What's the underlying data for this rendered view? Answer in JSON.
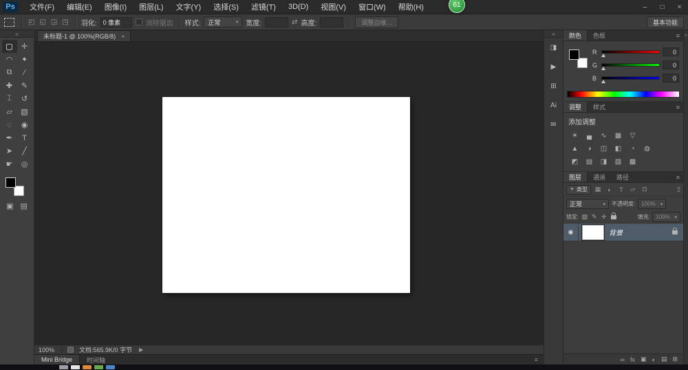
{
  "window": {
    "badge": "61",
    "minimize": "–",
    "maximize": "□",
    "close": "×"
  },
  "menubar": {
    "logo": "Ps",
    "items": [
      "文件(F)",
      "编辑(E)",
      "图像(I)",
      "图层(L)",
      "文字(Y)",
      "选择(S)",
      "滤镜(T)",
      "3D(D)",
      "视图(V)",
      "窗口(W)",
      "帮助(H)"
    ]
  },
  "options_bar": {
    "feather_label": "羽化:",
    "feather_value": "0 像素",
    "anti_alias_label": "消除锯齿",
    "style_label": "样式:",
    "style_value": "正常",
    "width_label": "宽度:",
    "width_value": "",
    "height_label": "高度:",
    "height_value": "",
    "refine_edge_label": "调整边缘…",
    "workspace_label": "基本功能"
  },
  "icons": {
    "caret": "▾",
    "swap": "⇄",
    "menu": "≡",
    "collapse_left": "«",
    "collapse_up": "«",
    "modes": [
      "◰",
      "◱",
      "◲",
      "◳"
    ],
    "funnel": "▼",
    "toggle": "▯"
  },
  "document_tab": {
    "title": "未标题-1 @ 100%(RGB/8)",
    "close": "×"
  },
  "toolbar": {
    "glyphs": [
      "▢",
      "✛",
      "◠",
      "✦",
      "⧉",
      "∕",
      "✚",
      "✎",
      "⌶",
      "↺",
      "▱",
      "▧",
      "◌",
      "◉",
      "✒",
      "T",
      "➤",
      "╱",
      "☛",
      "◎"
    ],
    "extras": [
      "▣",
      "▤"
    ]
  },
  "dock": {
    "icons": [
      "◨",
      "▶",
      "⊞",
      "Ai",
      "✉"
    ]
  },
  "panels": {
    "color": {
      "tabs": [
        "颜色",
        "色板"
      ],
      "foreground": "#000000",
      "background": "#ffffff",
      "sliders": [
        {
          "label": "R",
          "value": "0"
        },
        {
          "label": "G",
          "value": "0"
        },
        {
          "label": "B",
          "value": "0"
        }
      ]
    },
    "adjustments": {
      "tabs": [
        "调整",
        "样式"
      ],
      "title": "添加调整",
      "rows": [
        [
          "☀",
          "▄",
          "∿",
          "▦",
          "▽"
        ],
        [
          "▲",
          "◑",
          "◫",
          "◧",
          "◔",
          "◍"
        ],
        [
          "◩",
          "▤",
          "◨",
          "▧",
          "▩"
        ]
      ]
    },
    "layers": {
      "tabs": [
        "图层",
        "通道",
        "路径"
      ],
      "filter_label": "类型",
      "filter_icons": [
        "▦",
        "◐",
        "T",
        "▱",
        "⊡"
      ],
      "blend_mode": "正常",
      "opacity_label": "不透明度:",
      "opacity_value": "100%",
      "lock_label": "锁定:",
      "lock_icons": [
        "▨",
        "✎",
        "✛"
      ],
      "fill_label": "填充:",
      "fill_value": "100%",
      "layer": {
        "eye": "◉",
        "name": "背景"
      },
      "footer_icons": [
        "∞",
        "fx",
        "▣",
        "◐",
        "▤",
        "⊞"
      ]
    }
  },
  "status_bar": {
    "zoom": "100%",
    "doc_info": "文档:565.9K/0 字节",
    "arrow": "▶"
  },
  "bottom_bar": {
    "tabs": [
      "Mini Bridge",
      "时间轴"
    ]
  },
  "taskbar_colors": [
    "#9aa0a6",
    "#e6e6e6",
    "#d98a3a",
    "#6aa84f",
    "#4a86c8"
  ]
}
